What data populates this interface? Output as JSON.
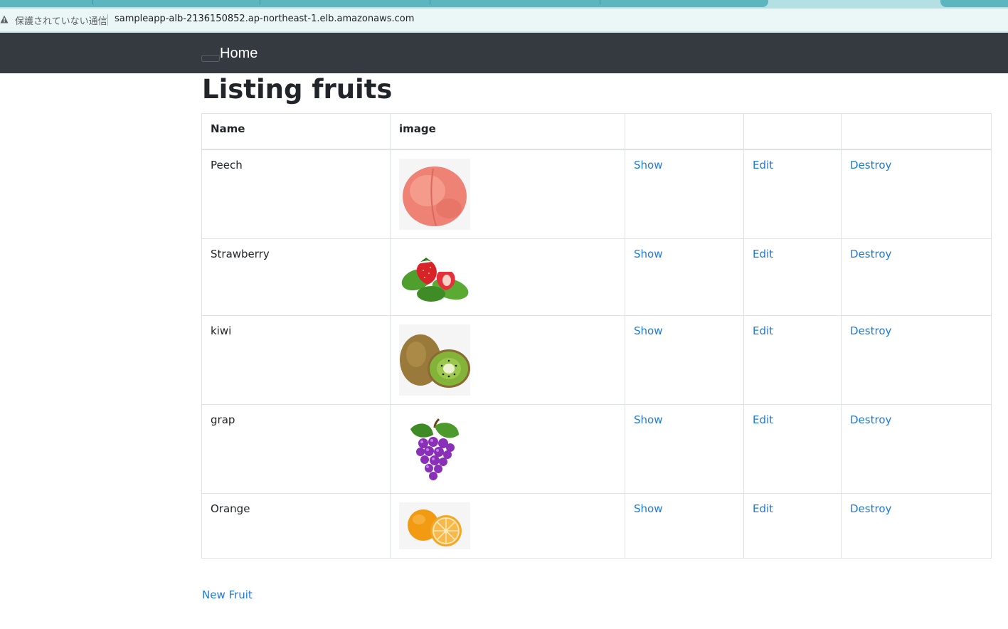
{
  "browser": {
    "security_label": "保護されていない通信",
    "url": "sampleapp-alb-2136150852.ap-northeast-1.elb.amazonaws.com"
  },
  "navbar": {
    "home_label": "Home"
  },
  "page": {
    "title": "Listing fruits",
    "new_link": "New Fruit"
  },
  "table": {
    "headers": [
      "Name",
      "image",
      "",
      "",
      ""
    ],
    "rows": [
      {
        "name": "Peech",
        "image": "peach",
        "show": "Show",
        "edit": "Edit",
        "destroy": "Destroy"
      },
      {
        "name": "Strawberry",
        "image": "strawberry",
        "show": "Show",
        "edit": "Edit",
        "destroy": "Destroy"
      },
      {
        "name": "kiwi",
        "image": "kiwi",
        "show": "Show",
        "edit": "Edit",
        "destroy": "Destroy"
      },
      {
        "name": "grap",
        "image": "grape",
        "show": "Show",
        "edit": "Edit",
        "destroy": "Destroy"
      },
      {
        "name": "Orange",
        "image": "orange",
        "show": "Show",
        "edit": "Edit",
        "destroy": "Destroy"
      }
    ]
  },
  "colors": {
    "navbar": "#343a40",
    "link": "#1e7ad6",
    "border": "#dee2e6"
  }
}
